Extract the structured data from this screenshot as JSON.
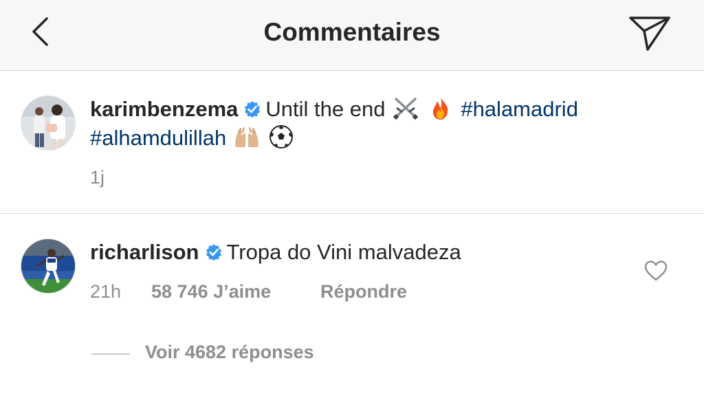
{
  "header": {
    "title": "Commentaires",
    "back_icon": "chevron-left-icon",
    "share_icon": "paper-plane-icon",
    "background": "#f7f7f7"
  },
  "caption": {
    "username": "karimbenzema",
    "verified": true,
    "text_before": "Until the end",
    "emojis": [
      "crossed-swords",
      "fire"
    ],
    "hashtags": [
      "#halamadrid",
      "#alhamdulillah"
    ],
    "emojis_after": [
      "raised-hands",
      "soccer-ball"
    ],
    "time": "1j"
  },
  "comment": {
    "username": "richarlison",
    "verified": true,
    "text": "Tropa do Vini malvadeza",
    "time": "21h",
    "likes": "58 746 J’aime",
    "reply_label": "Répondre",
    "like_icon": "heart-outline-icon"
  },
  "replies": {
    "label": "Voir 4682 réponses"
  },
  "colors": {
    "hashtag": "#003569",
    "verified": "#3897f0",
    "muted": "#8e8e8e",
    "text": "#262626"
  }
}
